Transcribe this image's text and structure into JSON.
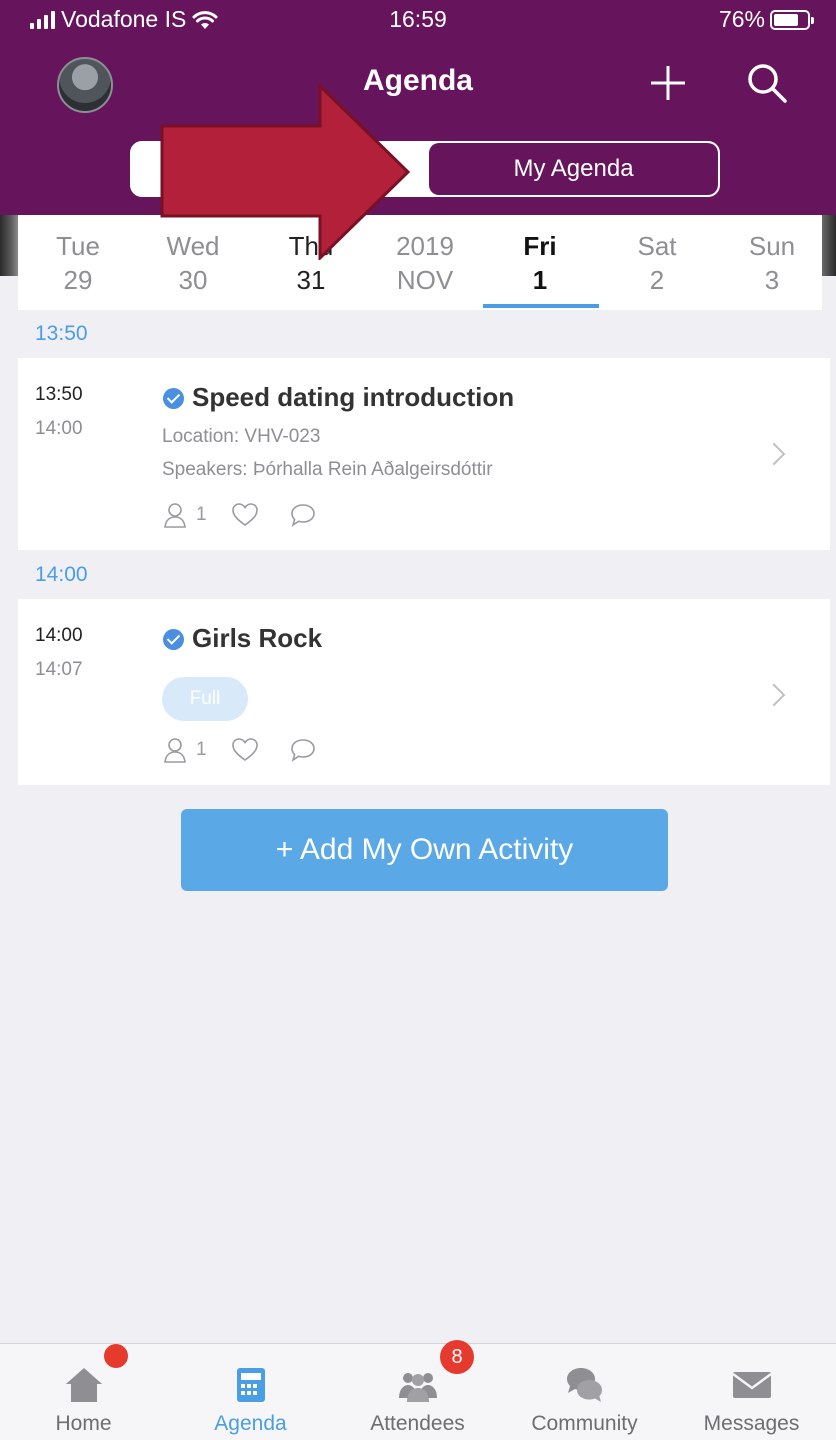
{
  "status_bar": {
    "carrier": "Vodafone IS",
    "time": "16:59",
    "battery": "76%"
  },
  "nav": {
    "title": "Agenda",
    "segment_right": "My Agenda"
  },
  "days": [
    {
      "dow": "Tue",
      "num": "29"
    },
    {
      "dow": "Wed",
      "num": "30"
    },
    {
      "dow": "Thu",
      "num": "31"
    },
    {
      "dow": "2019",
      "num": "NOV"
    },
    {
      "dow": "Fri",
      "num": "1"
    },
    {
      "dow": "Sat",
      "num": "2"
    },
    {
      "dow": "Sun",
      "num": "3"
    }
  ],
  "sections": [
    {
      "header": "13:50",
      "item": {
        "start": "13:50",
        "end": "14:00",
        "title": "Speed dating introduction",
        "location": "Location: VHV-023",
        "speakers": "Speakers: Þórhalla Rein Aðalgeirsdóttir",
        "attendees": "1"
      }
    },
    {
      "header": "14:00",
      "item": {
        "start": "14:00",
        "end": "14:07",
        "title": "Girls Rock",
        "status": "Full",
        "attendees": "1"
      }
    }
  ],
  "add_button": "+ Add My Own Activity",
  "tabs": [
    {
      "label": "Home",
      "icon": "home-icon"
    },
    {
      "label": "Agenda",
      "icon": "calendar-icon"
    },
    {
      "label": "Attendees",
      "icon": "attendees-icon",
      "badge": "8"
    },
    {
      "label": "Community",
      "icon": "community-icon"
    },
    {
      "label": "Messages",
      "icon": "envelope-icon"
    }
  ],
  "colors": {
    "header": "#66155c",
    "accent": "#4a9ee6",
    "button": "#5aa9e6",
    "annotation_arrow": "#b3203a",
    "badge": "#e63a2e"
  }
}
